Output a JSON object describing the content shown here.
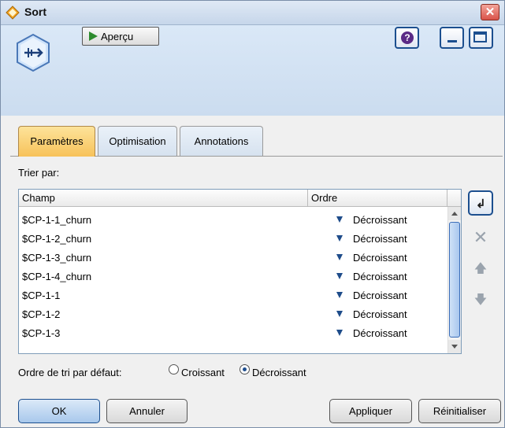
{
  "window": {
    "title": "Sort"
  },
  "toolbar": {
    "preview_label": "Aperçu",
    "help_glyph": "?"
  },
  "tabs": [
    {
      "label": "Paramètres"
    },
    {
      "label": "Optimisation"
    },
    {
      "label": "Annotations"
    }
  ],
  "sort": {
    "label": "Trier par:",
    "columns": [
      "Champ",
      "Ordre"
    ],
    "rows": [
      {
        "field": "$CP-1-1_churn",
        "order": "Décroissant"
      },
      {
        "field": "$CP-1-2_churn",
        "order": "Décroissant"
      },
      {
        "field": "$CP-1-3_churn",
        "order": "Décroissant"
      },
      {
        "field": "$CP-1-4_churn",
        "order": "Décroissant"
      },
      {
        "field": "$CP-1-1",
        "order": "Décroissant"
      },
      {
        "field": "$CP-1-2",
        "order": "Décroissant"
      },
      {
        "field": "$CP-1-3",
        "order": "Décroissant"
      }
    ]
  },
  "default_order": {
    "label": "Ordre de tri par défaut:",
    "options": [
      "Croissant",
      "Décroissant"
    ],
    "selected": "Décroissant"
  },
  "buttons": {
    "ok": "OK",
    "cancel": "Annuler",
    "apply": "Appliquer",
    "reset": "Réinitialiser"
  },
  "icons": [
    "app-diamond-icon",
    "sort-node-icon",
    "play-icon",
    "help-icon",
    "minimize-icon",
    "maximize-icon",
    "close-icon",
    "add-field-icon",
    "delete-icon",
    "move-up-icon",
    "move-down-icon",
    "sort-arrow-icon"
  ],
  "colors": {
    "active_tab": "#f7c25a",
    "header_gradient": "#cbdcef",
    "accent": "#1c4f8f"
  }
}
